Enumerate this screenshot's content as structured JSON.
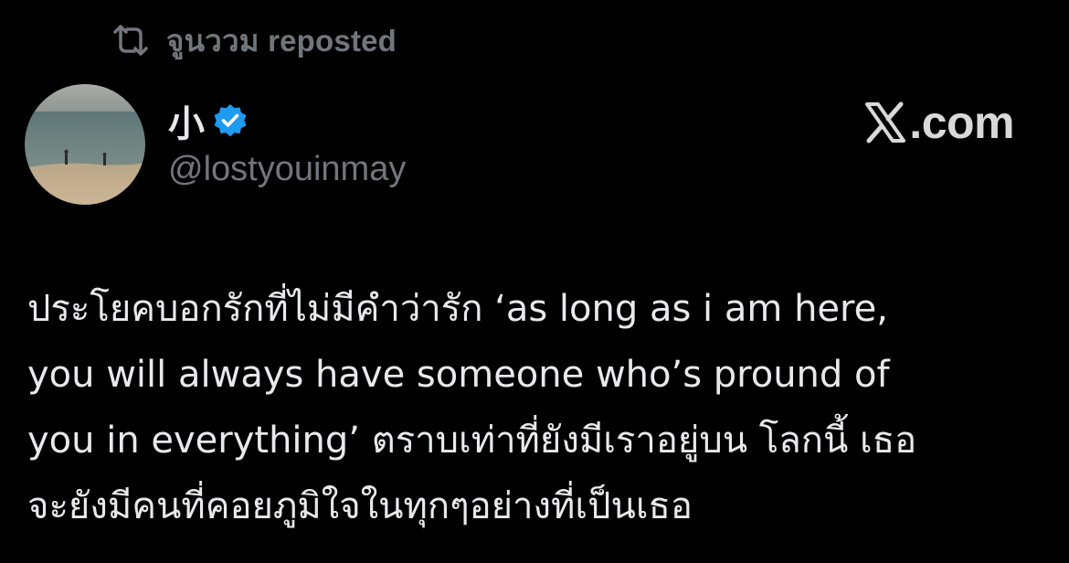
{
  "repost": {
    "icon": "repost-icon",
    "text": "จูนววม reposted"
  },
  "author": {
    "avatar_icon": "avatar-beach-photo",
    "display_name": "小",
    "verified_icon": "verified-badge-icon",
    "handle": "@lostyouinmay"
  },
  "source": {
    "icon": "x-logo-icon",
    "label": ".com"
  },
  "post": {
    "lines": [
      "ประโยคบอกรักที่ไม่มีคำว่ารัก ‘as long as i am here,",
      "you will always have someone who’s pround of",
      "you in everything’ ตราบเท่าที่ยังมีเราอยู่บน โลกนี้ เธอ",
      "จะยังมีคนที่คอยภูมิใจในทุกๆอย่างที่เป็นเธอ"
    ]
  },
  "colors": {
    "background": "#000000",
    "primary_text": "#e7e9ea",
    "secondary_text": "#71767b",
    "verified_blue": "#1d9bf0"
  }
}
